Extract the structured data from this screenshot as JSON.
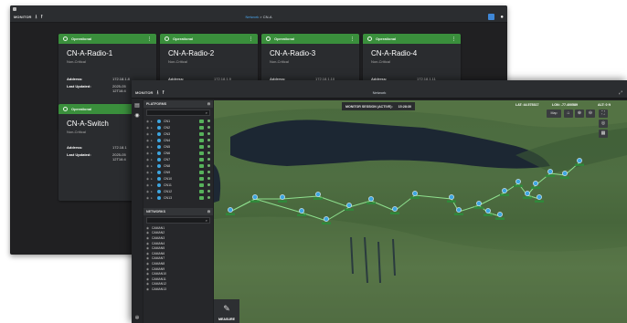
{
  "bg_window": {
    "app_label": "MONITOR",
    "breadcrumb_parent": "Network",
    "breadcrumb_sep": ">",
    "breadcrumb_current": "CN-A",
    "cards": [
      {
        "status": "Operational",
        "name": "CN-A-Radio-1",
        "criticality": "Non-Critical",
        "address_label": "Address:",
        "address": "172.18.1.8",
        "updated_label": "Last Updated:",
        "updated_line1": "2025-05",
        "updated_line2": "12T16:4"
      },
      {
        "status": "Operational",
        "name": "CN-A-Radio-2",
        "criticality": "Non-Critical",
        "address_label": "Address:",
        "address": "172.18.1.9"
      },
      {
        "status": "Operational",
        "name": "CN-A-Radio-3",
        "criticality": "Non-Critical",
        "address_label": "Address:",
        "address": "172.18.1.10"
      },
      {
        "status": "Operational",
        "name": "CN-A-Radio-4",
        "criticality": "Non-Critical",
        "address_label": "Address:",
        "address": "172.18.1.11"
      },
      {
        "status": "Operational",
        "name": "CN-A-Switch",
        "criticality": "Non-Critical",
        "address_label": "Address:",
        "address": "172.18.1",
        "updated_label": "Last Updated:",
        "updated_line1": "2025-05",
        "updated_line2": "12T16:4"
      }
    ]
  },
  "fg_window": {
    "app_label": "MONITOR",
    "title": "Network",
    "platforms_header": "PLATFORMS",
    "platforms": [
      "CN1",
      "CN2",
      "CN3",
      "CN4",
      "CN5",
      "CN6",
      "CN7",
      "CN8",
      "CN9",
      "CN10",
      "CN11",
      "CN12",
      "CN13"
    ],
    "networks_header": "NETWORKS",
    "networks": [
      "CAMAN1",
      "CAMAN2",
      "CAMAN3",
      "CAMAN4",
      "CAMAN5",
      "CAMAN6",
      "CAMAN7",
      "CAMAN8",
      "CAMAN9",
      "CAMAN10",
      "CAMAN11",
      "CAMAN12",
      "CAMAN13"
    ],
    "monitor_session": "MONITOR SESSION (ACTIVE):",
    "session_time": "15:28:30",
    "lat": "LAT: 44.575317",
    "lon": "LON: -77.400589",
    "alt": "ALT: 0 ft",
    "measure_label": "MEASURE",
    "map_view_label": "Map"
  },
  "colors": {
    "operational": "#3a8f3c",
    "accent": "#4aa3e8",
    "node": "#3ea6e0",
    "link": "#8ee08e"
  }
}
